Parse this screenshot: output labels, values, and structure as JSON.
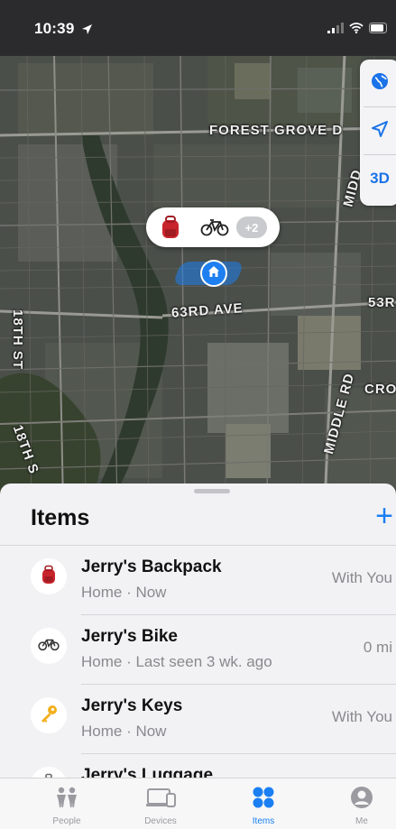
{
  "status_bar": {
    "time": "10:39",
    "icons": [
      "location-arrow-icon",
      "signal-icon",
      "wifi-icon",
      "battery-icon"
    ]
  },
  "map": {
    "labels": {
      "forest_grove": "FOREST GROVE D",
      "ave_63rd": "63RD AVE",
      "st_18th_a": "18TH ST",
      "st_18th_b": "18TH S",
      "middle_rd": "MIDDLE RD",
      "midd": "MIDD",
      "cro": "CRO",
      "r53": "53R"
    },
    "controls": {
      "globe": "globe-icon",
      "locate": "location-arrow-icon",
      "view_3d": "3D"
    },
    "cluster": {
      "icons": [
        "backpack-icon",
        "bike-icon"
      ],
      "count_label": "+2"
    },
    "home_pin": "home-icon"
  },
  "sheet": {
    "title": "Items",
    "add_label": "+",
    "items": [
      {
        "name": "Jerry's Backpack",
        "detail": "Home · Now",
        "distance": "With You",
        "icon": "backpack-icon"
      },
      {
        "name": "Jerry's Bike",
        "detail": "Home · Last seen 3 wk. ago",
        "distance": "0 mi",
        "icon": "bike-icon"
      },
      {
        "name": "Jerry's Keys",
        "detail": "Home · Now",
        "distance": "With You",
        "icon": "key-icon"
      },
      {
        "name": "Jerry's Luggage",
        "detail": "",
        "distance": "",
        "icon": "luggage-icon"
      }
    ]
  },
  "tabbar": {
    "tabs": [
      {
        "label": "People",
        "icon": "people-icon",
        "active": false
      },
      {
        "label": "Devices",
        "icon": "devices-icon",
        "active": false
      },
      {
        "label": "Items",
        "icon": "items-icon",
        "active": true
      },
      {
        "label": "Me",
        "icon": "me-icon",
        "active": false
      }
    ]
  },
  "colors": {
    "accent": "#1a7ff2",
    "status_bar": "#2b2b2d",
    "sheet_bg": "#f2f2f4"
  }
}
